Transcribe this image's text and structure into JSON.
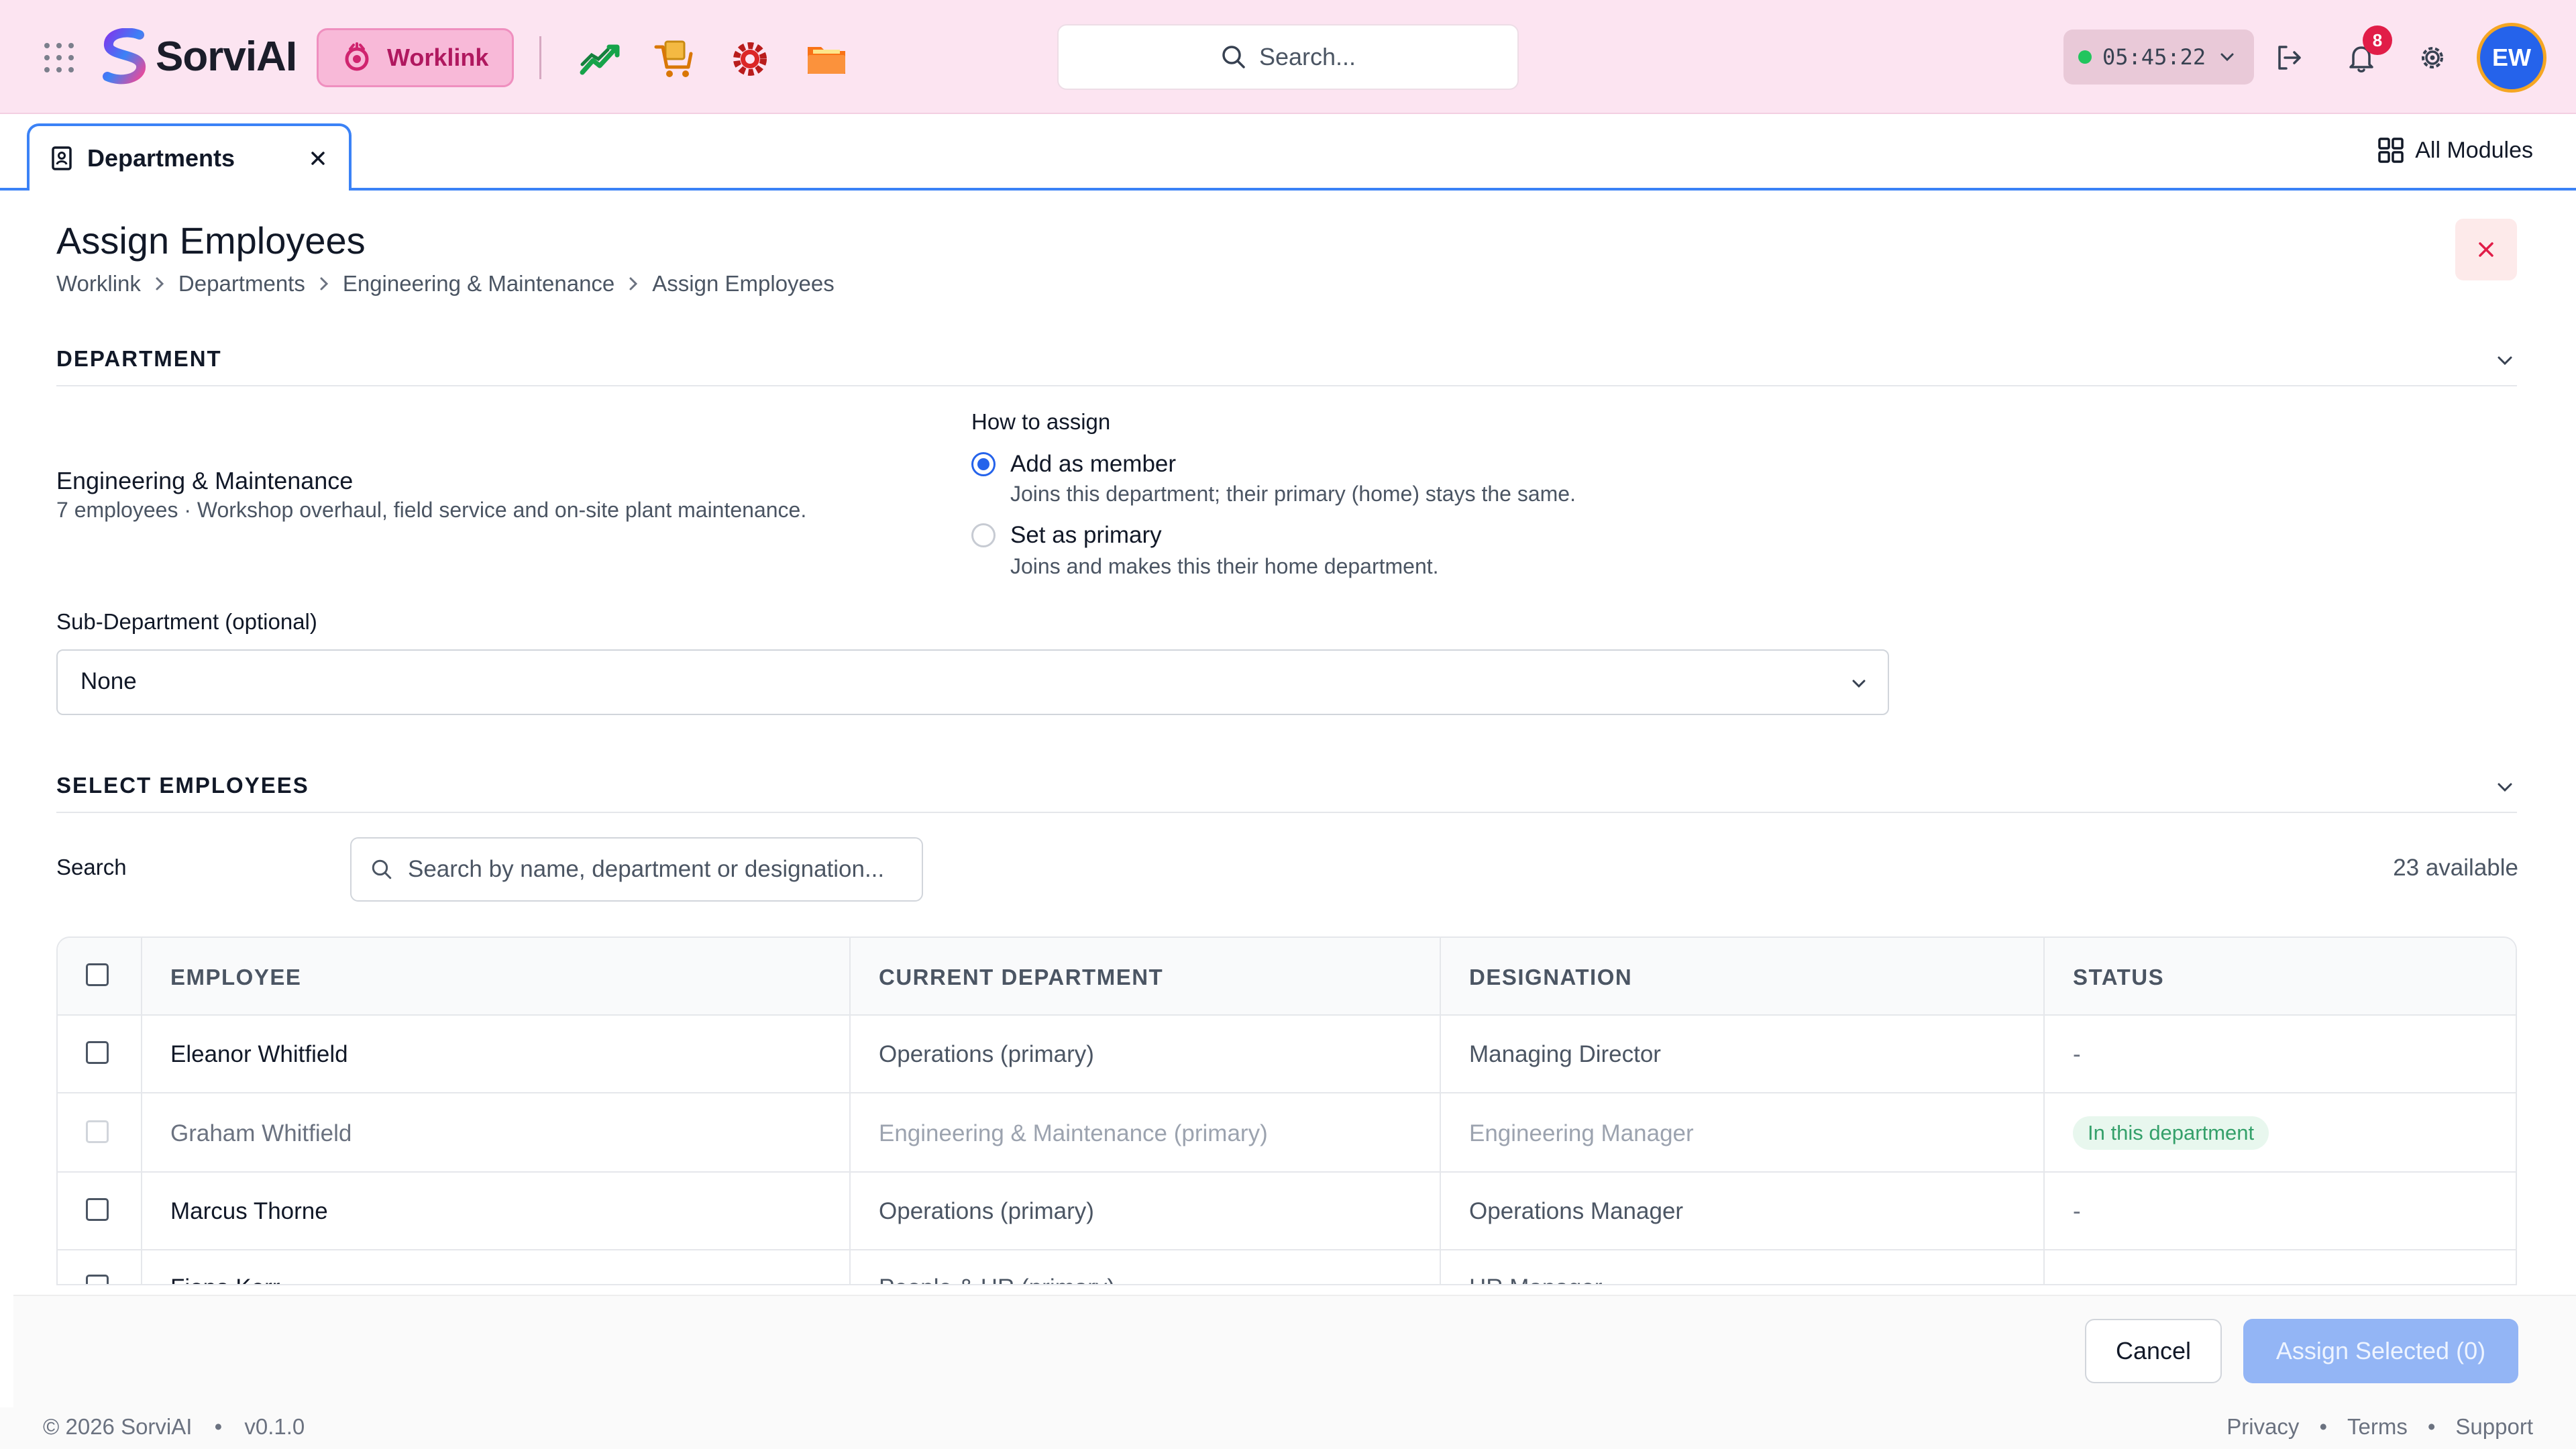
{
  "app": {
    "name": "SorviAI",
    "module": "Worklink",
    "search_placeholder": "Search...",
    "timer": "05:45:22",
    "notification_count": "8",
    "user_initials": "EW",
    "colors": {
      "accent": "#2563eb",
      "brand_pink": "#fce4f1",
      "worklink": "#b0185f"
    }
  },
  "tabs": {
    "active_label": "Departments",
    "all_modules_label": "All Modules"
  },
  "page": {
    "title": "Assign Employees",
    "breadcrumb": [
      "Worklink",
      "Departments",
      "Engineering & Maintenance",
      "Assign Employees"
    ]
  },
  "department_section": {
    "heading": "DEPARTMENT",
    "name": "Engineering & Maintenance",
    "description": "7 employees · Workshop overhaul, field service and on-site plant maintenance.",
    "how_to_assign_label": "How to assign",
    "options": [
      {
        "title": "Add as member",
        "description": "Joins this department; their primary (home) stays the same.",
        "selected": true
      },
      {
        "title": "Set as primary",
        "description": "Joins and makes this their home department.",
        "selected": false
      }
    ],
    "sub_department_label": "Sub-Department (optional)",
    "sub_department_value": "None"
  },
  "employees_section": {
    "heading": "SELECT EMPLOYEES",
    "search_label": "Search",
    "search_placeholder": "Search by name, department or designation...",
    "available_text": "23 available",
    "columns": [
      "EMPLOYEE",
      "CURRENT DEPARTMENT",
      "DESIGNATION",
      "STATUS"
    ],
    "rows": [
      {
        "name": "Eleanor Whitfield",
        "department": "Operations (primary)",
        "designation": "Managing Director",
        "status": "-"
      },
      {
        "name": "Graham Whitfield",
        "department": "Engineering & Maintenance (primary)",
        "designation": "Engineering Manager",
        "status": "In this department"
      },
      {
        "name": "Marcus Thorne",
        "department": "Operations (primary)",
        "designation": "Operations Manager",
        "status": "-"
      },
      {
        "name": "Fiona Kerr",
        "department": "People & HR (primary)",
        "designation": "HR Manager",
        "status": "-"
      }
    ]
  },
  "actions": {
    "cancel_label": "Cancel",
    "assign_label": "Assign Selected (0)"
  },
  "footer": {
    "copyright": "© 2026 SorviAI",
    "version": "v0.1.0",
    "links": [
      "Privacy",
      "Terms",
      "Support"
    ]
  }
}
